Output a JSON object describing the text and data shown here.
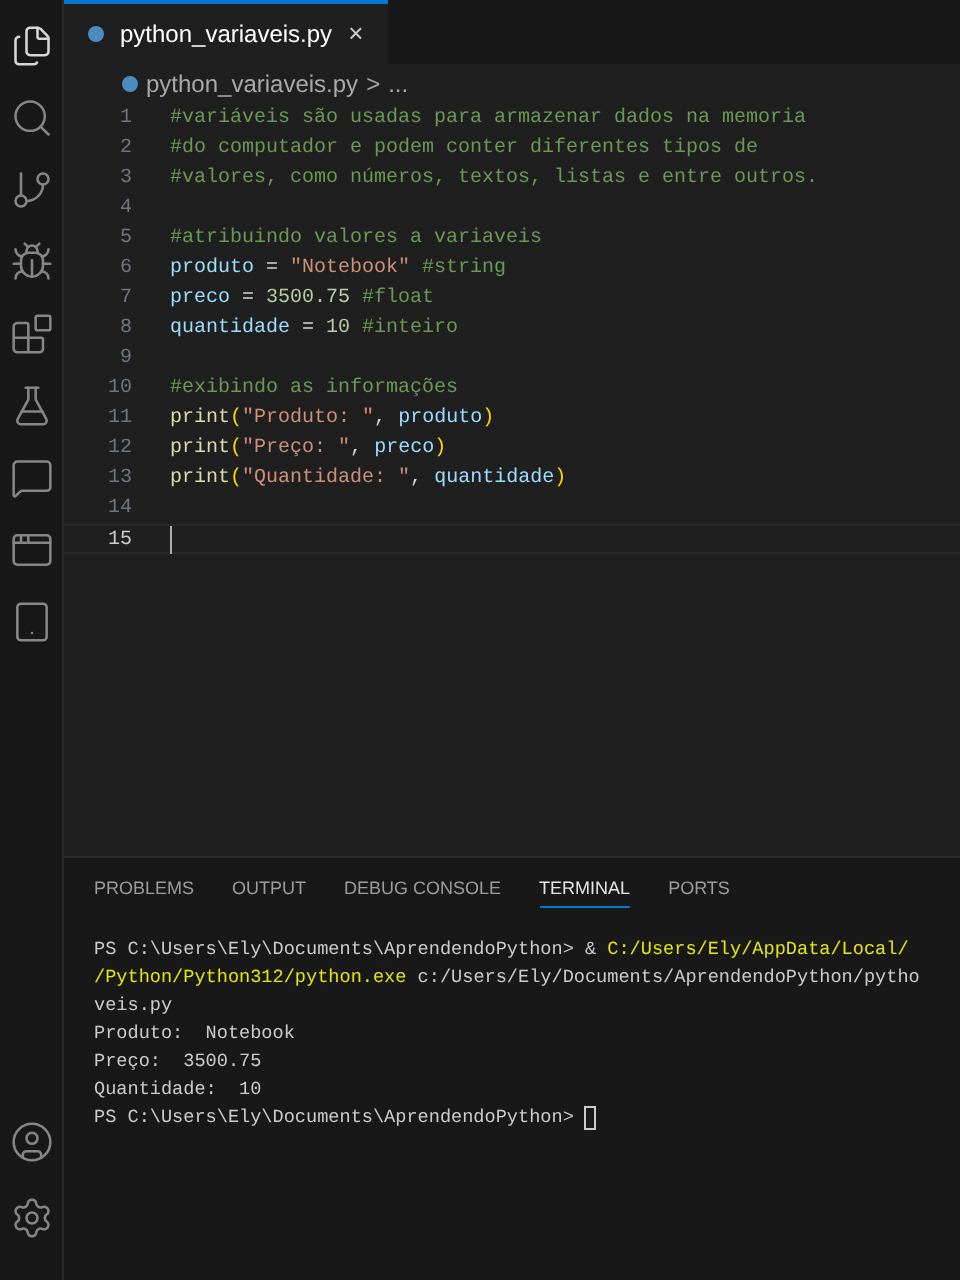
{
  "activity_bar": {
    "items": [
      {
        "kind": "files",
        "selected": true
      },
      {
        "kind": "search",
        "selected": false
      },
      {
        "kind": "source-control",
        "selected": false
      },
      {
        "kind": "run-debug",
        "selected": false
      },
      {
        "kind": "extensions",
        "selected": false
      },
      {
        "kind": "testing",
        "selected": false
      },
      {
        "kind": "chat",
        "selected": false
      },
      {
        "kind": "windows",
        "selected": false
      },
      {
        "kind": "device",
        "selected": false
      }
    ],
    "bottom_items": [
      {
        "kind": "account"
      },
      {
        "kind": "settings"
      }
    ]
  },
  "tabs": [
    {
      "label": "python_variaveis.py",
      "selected": true,
      "close": "×"
    }
  ],
  "breadcrumb": {
    "file": "python_variaveis.py",
    "separator": ">",
    "more": "..."
  },
  "editor": {
    "lines": [
      {
        "number": "1",
        "tokens": [
          {
            "t": "#variáveis são usadas para armazenar dados na memoria",
            "kind": "comment"
          }
        ]
      },
      {
        "number": "2",
        "tokens": [
          {
            "t": "#do computador e podem conter diferentes tipos de",
            "kind": "comment"
          }
        ]
      },
      {
        "number": "3",
        "tokens": [
          {
            "t": "#valores, como números, textos, listas e entre outros.",
            "kind": "comment"
          }
        ]
      },
      {
        "number": "4",
        "current": false
      },
      {
        "number": "5",
        "tokens": [
          {
            "t": "#atribuindo valores a variaveis",
            "kind": "comment"
          }
        ]
      },
      {
        "number": "6",
        "tokens": [
          {
            "t": "produto",
            "kind": "var"
          },
          {
            "t": " = ",
            "kind": "op"
          },
          {
            "t": "\"Notebook\"",
            "kind": "string"
          },
          {
            "t": " #string",
            "kind": "comment"
          }
        ]
      },
      {
        "number": "7",
        "tokens": [
          {
            "t": "preco",
            "kind": "var"
          },
          {
            "t": " = ",
            "kind": "op"
          },
          {
            "t": "3500.75",
            "kind": "number"
          },
          {
            "t": " #float",
            "kind": "comment"
          }
        ]
      },
      {
        "number": "8",
        "tokens": [
          {
            "t": "quantidade",
            "kind": "var"
          },
          {
            "t": " = ",
            "kind": "op"
          },
          {
            "t": "10",
            "kind": "number"
          },
          {
            "t": " #inteiro",
            "kind": "comment"
          }
        ]
      },
      {
        "number": "9",
        "current": false
      },
      {
        "number": "10",
        "tokens": [
          {
            "t": "#exibindo as informações",
            "kind": "comment"
          }
        ]
      },
      {
        "number": "11",
        "tokens": [
          {
            "t": "print",
            "kind": "func"
          },
          {
            "t": "(",
            "kind": "paren"
          },
          {
            "t": "\"Produto: \"",
            "kind": "string"
          },
          {
            "t": ", ",
            "kind": "op"
          },
          {
            "t": "produto",
            "kind": "var"
          },
          {
            "t": ")",
            "kind": "paren"
          }
        ]
      },
      {
        "number": "12",
        "tokens": [
          {
            "t": "print",
            "kind": "func"
          },
          {
            "t": "(",
            "kind": "paren"
          },
          {
            "t": "\"Preço: \"",
            "kind": "string"
          },
          {
            "t": ", ",
            "kind": "op"
          },
          {
            "t": "preco",
            "kind": "var"
          },
          {
            "t": ")",
            "kind": "paren"
          }
        ]
      },
      {
        "number": "13",
        "tokens": [
          {
            "t": "print",
            "kind": "func"
          },
          {
            "t": "(",
            "kind": "paren"
          },
          {
            "t": "\"Quantidade: \"",
            "kind": "string"
          },
          {
            "t": ", ",
            "kind": "op"
          },
          {
            "t": "quantidade",
            "kind": "var"
          },
          {
            "t": ")",
            "kind": "paren"
          }
        ]
      },
      {
        "number": "14",
        "current": false
      },
      {
        "number": "15",
        "current": true
      }
    ]
  },
  "panel": {
    "tabs": [
      {
        "label": "PROBLEMS",
        "selected": false
      },
      {
        "label": "OUTPUT",
        "selected": false
      },
      {
        "label": "DEBUG CONSOLE",
        "selected": false
      },
      {
        "label": "TERMINAL",
        "selected": true
      },
      {
        "label": "PORTS",
        "selected": false
      }
    ],
    "terminal": {
      "lines": [
        [
          {
            "t": "PS C:\\Users\\Ely\\Documents\\AprendendoPython> & ",
            "kind": "plain"
          },
          {
            "t": "C:/Users/Ely/AppData/Local/",
            "kind": "path"
          }
        ],
        [
          {
            "t": "/Python/Python312/python.exe",
            "kind": "path"
          },
          {
            "t": " c:/Users/Ely/Documents/AprendendoPython/pytho",
            "kind": "plain"
          }
        ],
        [
          {
            "t": "veis.py",
            "kind": "plain"
          }
        ],
        [
          {
            "t": "Produto:  Notebook",
            "kind": "plain"
          }
        ],
        [
          {
            "t": "Preço:  3500.75",
            "kind": "plain"
          }
        ],
        [
          {
            "t": "Quantidade:  10",
            "kind": "plain"
          }
        ],
        [
          {
            "t": "PS C:\\Users\\Ely\\Documents\\AprendendoPython> ",
            "kind": "plain"
          }
        ]
      ],
      "cursor": true
    }
  }
}
